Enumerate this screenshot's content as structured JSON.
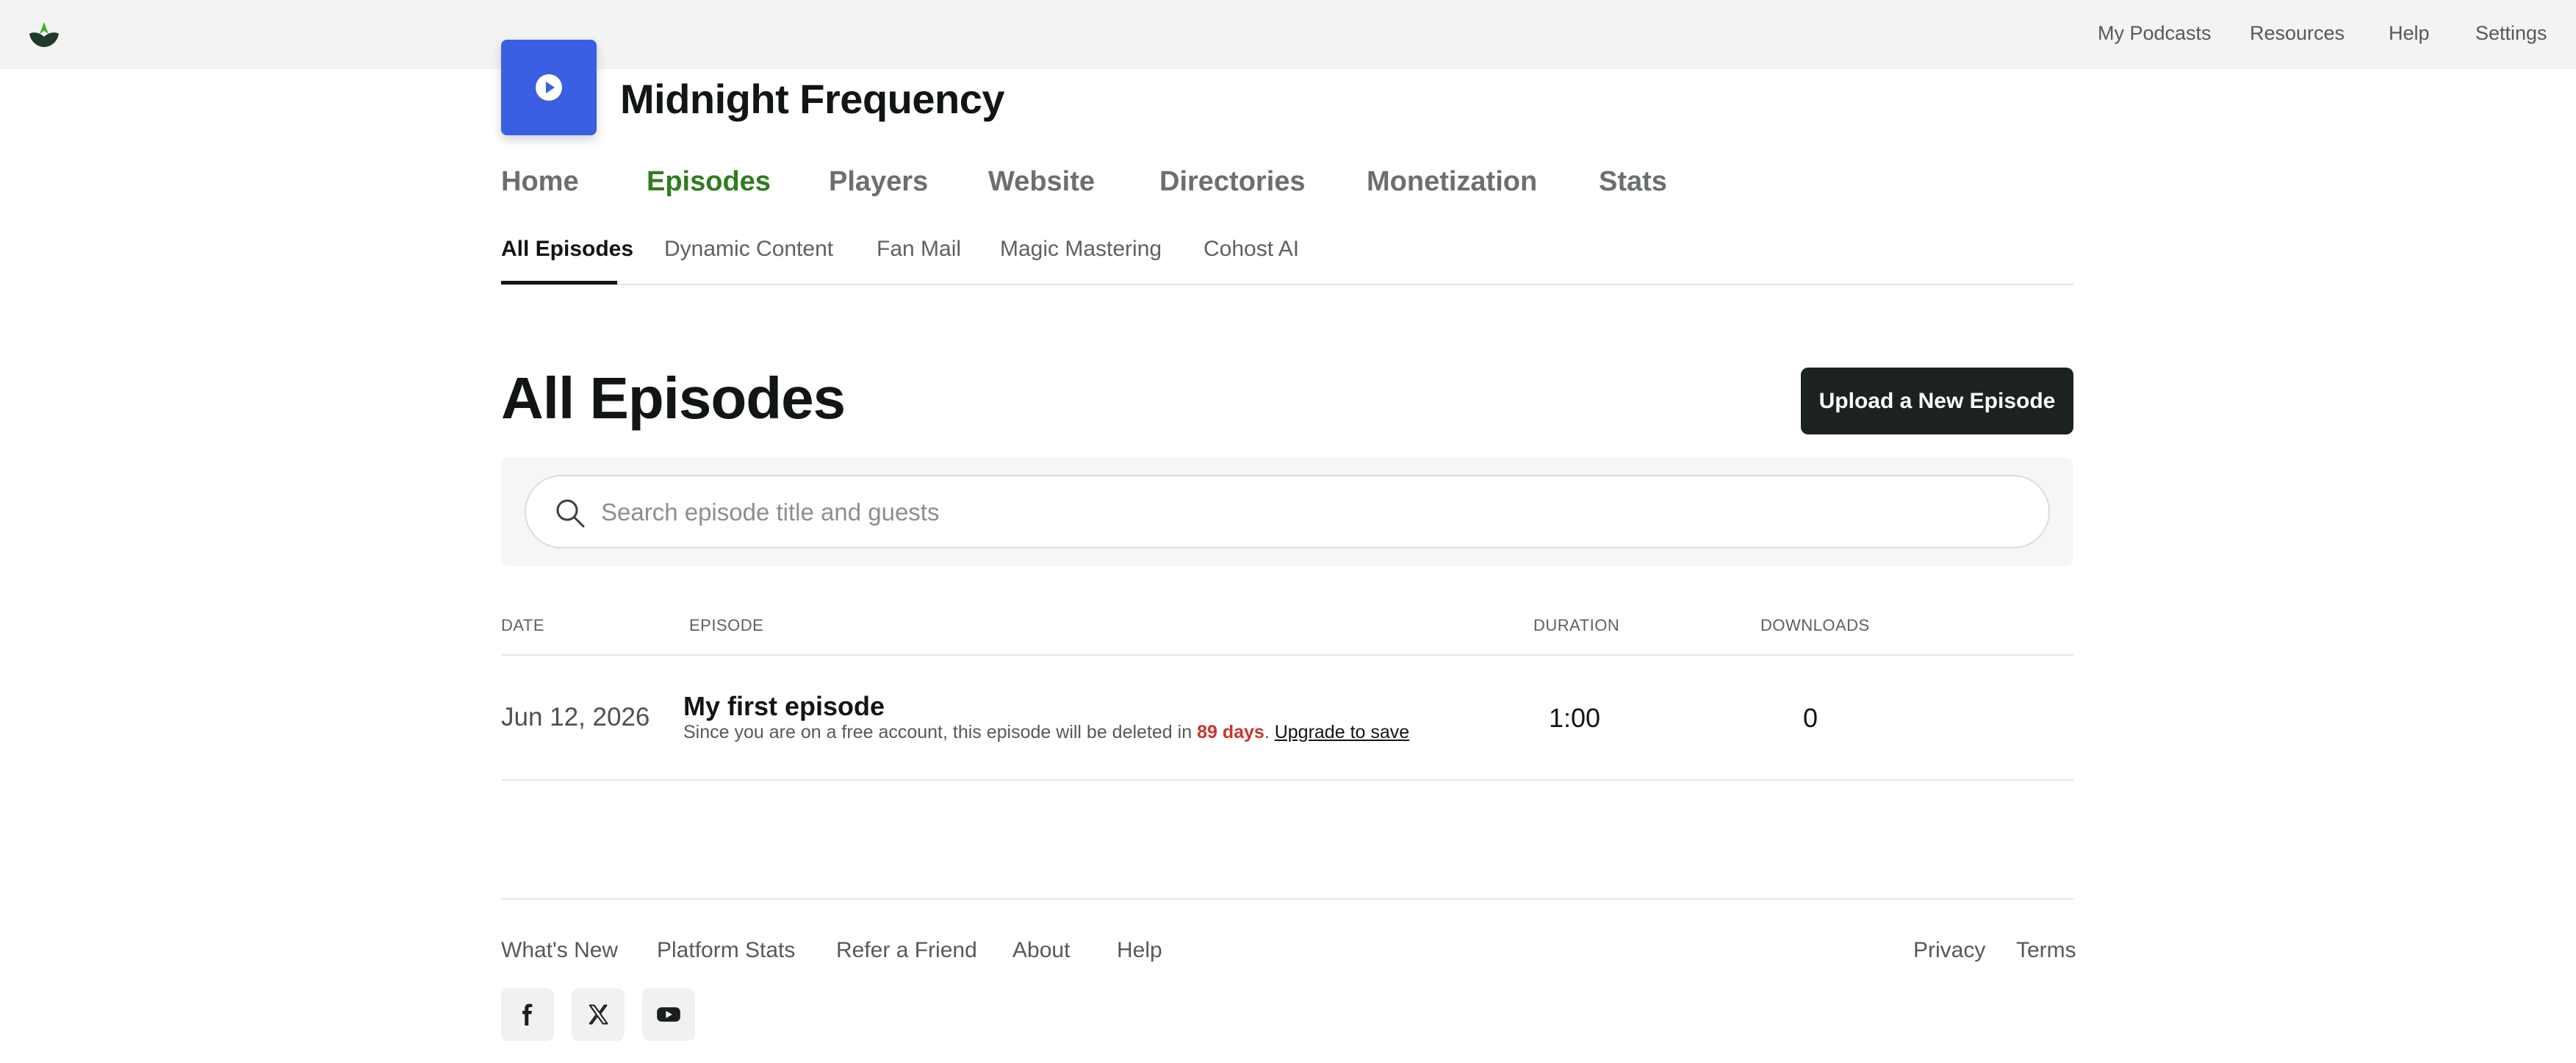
{
  "topbar": {
    "nav": [
      "My Podcasts",
      "Resources",
      "Help",
      "Settings"
    ]
  },
  "podcast": {
    "title": "Midnight Frequency",
    "art_color": "#3a5fe3"
  },
  "main_nav": {
    "items": [
      "Home",
      "Episodes",
      "Players",
      "Website",
      "Directories",
      "Monetization",
      "Stats"
    ],
    "active": "Episodes"
  },
  "sub_nav": {
    "items": [
      "All Episodes",
      "Dynamic Content",
      "Fan Mail",
      "Magic Mastering",
      "Cohost AI"
    ],
    "active": "All Episodes"
  },
  "page": {
    "title": "All Episodes",
    "upload_label": "Upload a New Episode"
  },
  "search": {
    "placeholder": "Search episode title and guests",
    "value": ""
  },
  "table": {
    "headers": {
      "date": "DATE",
      "episode": "EPISODE",
      "duration": "DURATION",
      "downloads": "DOWNLOADS"
    },
    "rows": [
      {
        "date": "Jun 12, 2026",
        "title": "My first episode",
        "note_prefix": "Since you are on a free account, this episode will be deleted in ",
        "note_days": "89 days",
        "note_sep": ". ",
        "note_link": "Upgrade to save",
        "duration": "1:00",
        "downloads": "0"
      }
    ]
  },
  "footer": {
    "links": [
      "What's New",
      "Platform Stats",
      "Refer a Friend",
      "About",
      "Help"
    ],
    "legal": [
      "Privacy",
      "Terms"
    ],
    "social": [
      "facebook-icon",
      "x-icon",
      "youtube-icon"
    ]
  },
  "colors": {
    "accent_green": "#2f7d1f",
    "danger": "#c9352b",
    "dark_button": "#1c2220"
  }
}
